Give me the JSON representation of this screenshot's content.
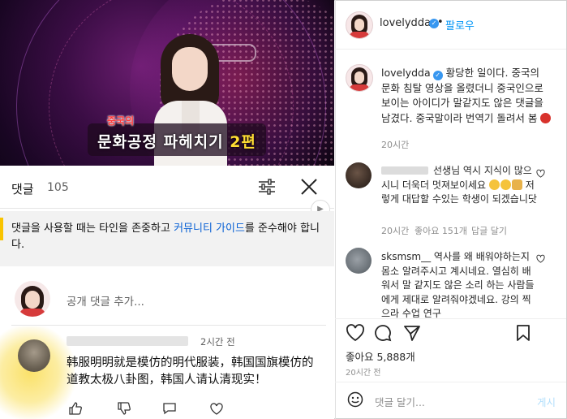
{
  "video": {
    "caption_top": "중국의",
    "caption_main": "문화공정 파헤치기",
    "caption_num": "2편"
  },
  "youtube_comments": {
    "title": "댓글",
    "count": "105",
    "notice_part1": "댓글을 사용할 때는 타인을 존중하고 ",
    "notice_link": "커뮤니티 가이드",
    "notice_part2": "를 준수해야 합니다.",
    "add_placeholder": "공개 댓글 추가...",
    "comment": {
      "time": "2시간 전",
      "text": "韩服明明就是模仿的明代服装，韩国国旗模仿的道教太极八卦图，韩国人请认清现实！"
    }
  },
  "instagram": {
    "username": "lovelydda",
    "follow_label": "팔로우",
    "caption_text": " 황당한 일이다. 중국의 문화 침탈 영상을 올렸더니 중국인으로 보이는 아이디가 말같지도 않은 댓글을 남겼다. 중국말이라 번역기 돌려서 봄",
    "caption_time": "20시간",
    "comments": [
      {
        "text_a": " 선생님 역시 지식이 많으시니 더욱더 멋져보이세요 ",
        "text_b": " 저렇게 대답할 수있는 학생이 되겠습니닷",
        "time": "20시간",
        "likes": "좋아요 151개",
        "reply": "답글 달기"
      },
      {
        "user": "sksmsm__",
        "text": " 역사를 왜 배워야하는지 몸소 알려주시고 계시네요. 열심히 배워서 말 같지도 않은 소리 하는 사람들에게 제대로 알려줘야겠네요. 강의 찍으라 수업 연구"
      }
    ],
    "likes": "좋아요 5,888개",
    "post_time": "20시간 전",
    "add_placeholder": "댓글 달기...",
    "post_label": "게시"
  }
}
